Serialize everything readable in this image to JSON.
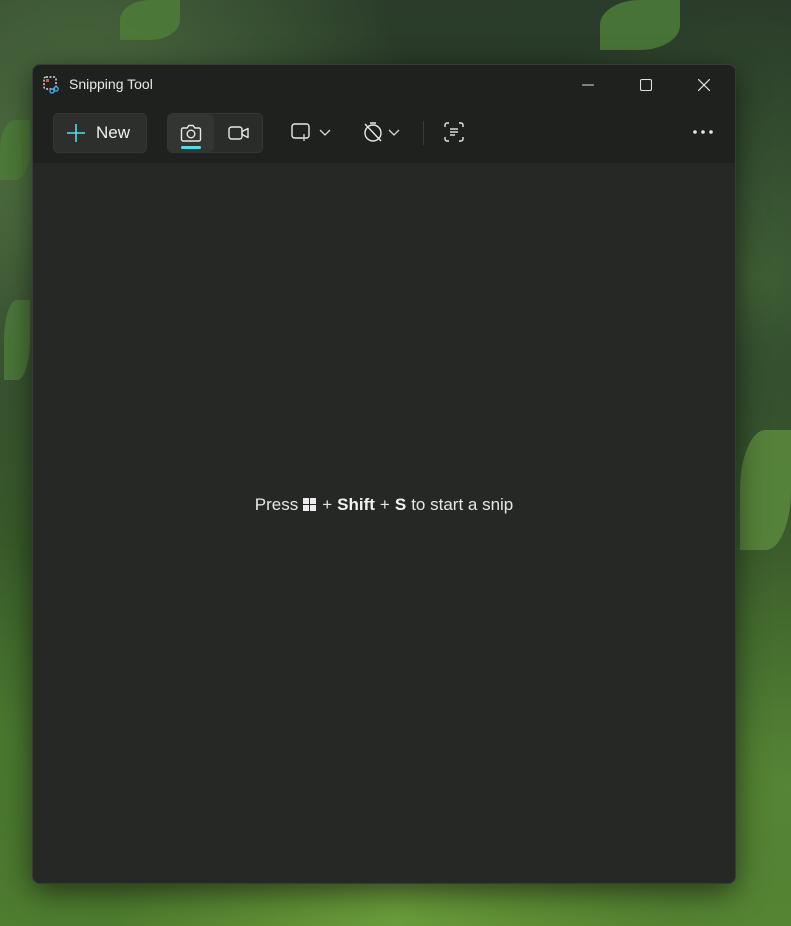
{
  "window": {
    "title": "Snipping Tool"
  },
  "toolbar": {
    "new_label": "New",
    "modes": [
      {
        "name": "snip",
        "icon": "camera-icon",
        "active": true
      },
      {
        "name": "record",
        "icon": "video-camera-icon",
        "active": false
      }
    ],
    "snip_shape_icon": "rectangle-snip-icon",
    "delay_icon": "no-timer-icon",
    "text_actions_icon": "text-actions-icon",
    "more_icon": "more-ellipsis-icon"
  },
  "content": {
    "hint_press": "Press",
    "hint_plus1": "+",
    "hint_shift": "Shift",
    "hint_plus2": "+",
    "hint_s": "S",
    "hint_rest": "to start a snip"
  },
  "colors": {
    "accent": "#4fe0e6",
    "window_bg": "#262826",
    "titlebar_bg": "#1f211f"
  }
}
